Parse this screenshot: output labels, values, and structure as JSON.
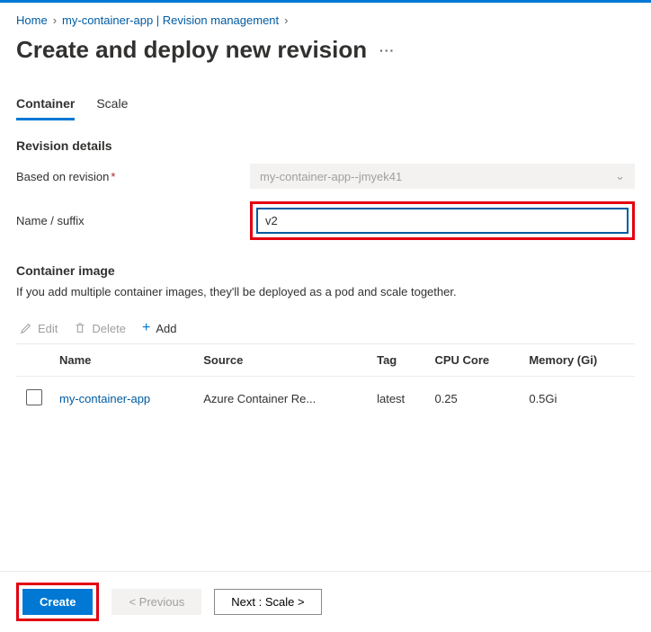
{
  "breadcrumb": {
    "home": "Home",
    "parent": "my-container-app | Revision management"
  },
  "page": {
    "title": "Create and deploy new revision"
  },
  "tabs": {
    "container": "Container",
    "scale": "Scale"
  },
  "revision_details": {
    "heading": "Revision details",
    "based_on_label": "Based on revision",
    "based_on_value": "my-container-app--jmyek41",
    "name_label": "Name / suffix",
    "name_value": "v2"
  },
  "container_image": {
    "heading": "Container image",
    "description": "If you add multiple container images, they'll be deployed as a pod and scale together."
  },
  "toolbar": {
    "edit": "Edit",
    "delete": "Delete",
    "add": "Add"
  },
  "table": {
    "headers": {
      "name": "Name",
      "source": "Source",
      "tag": "Tag",
      "cpu": "CPU Core",
      "memory": "Memory (Gi)"
    },
    "rows": [
      {
        "name": "my-container-app",
        "source": "Azure Container Re...",
        "tag": "latest",
        "cpu": "0.25",
        "memory": "0.5Gi"
      }
    ]
  },
  "footer": {
    "create": "Create",
    "previous": "< Previous",
    "next": "Next : Scale >"
  }
}
